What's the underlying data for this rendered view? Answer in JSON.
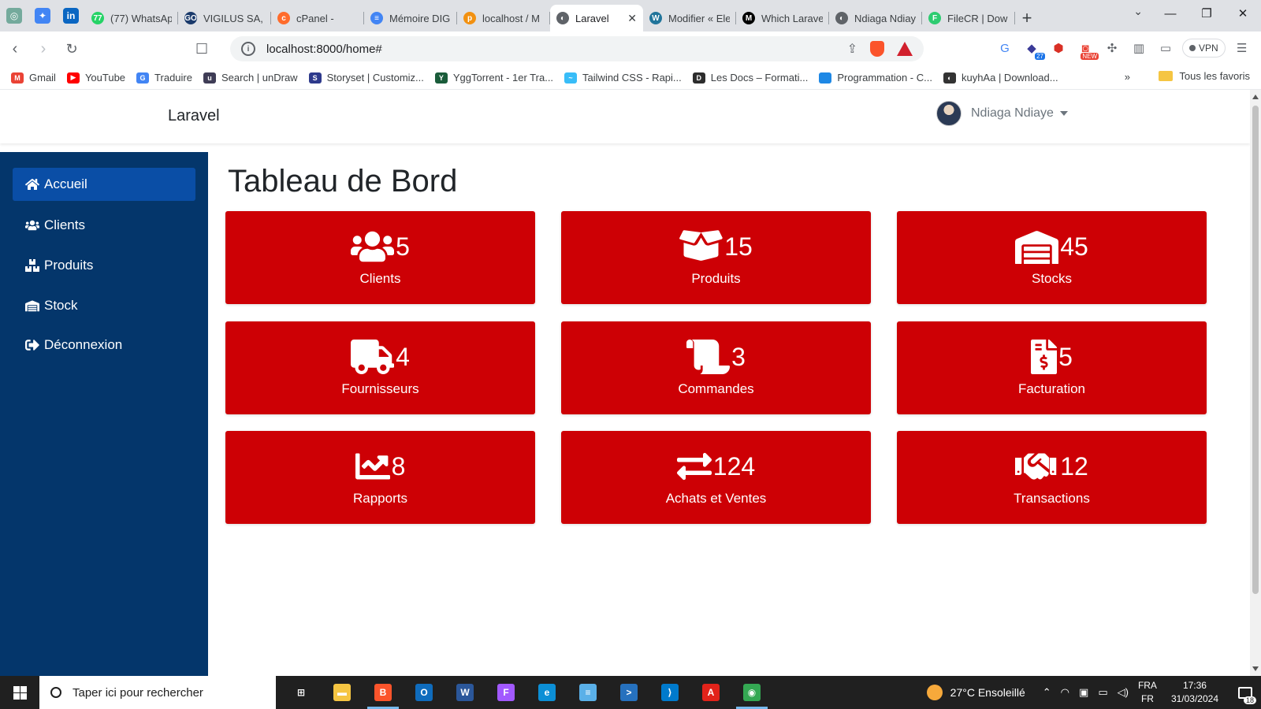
{
  "browser": {
    "pinned_tabs": [
      {
        "icon": "chatgpt-icon",
        "color": "#74aa9c",
        "glyph": "◎"
      },
      {
        "icon": "gemini-icon",
        "color": "#4285f4",
        "glyph": "✦"
      },
      {
        "icon": "linkedin-icon",
        "color": "#0a66c2",
        "glyph": "in"
      }
    ],
    "tabs": [
      {
        "title": "(77) WhatsAp",
        "color": "#25d366",
        "glyph": "77"
      },
      {
        "title": "VIGILUS SA, c",
        "color": "#1a3a6b",
        "glyph": "GO"
      },
      {
        "title": "cPanel -",
        "color": "#ff6c2c",
        "glyph": "c"
      },
      {
        "title": "Mémoire DIG",
        "color": "#4285f4",
        "glyph": "≡"
      },
      {
        "title": "localhost / M",
        "color": "#f29111",
        "glyph": "p"
      },
      {
        "title": "Laravel",
        "color": "#5f6368",
        "glyph": "◐",
        "active": true
      },
      {
        "title": "Modifier « Ele",
        "color": "#21759b",
        "glyph": "W"
      },
      {
        "title": "Which Larave",
        "color": "#000000",
        "glyph": "M"
      },
      {
        "title": "Ndiaga Ndiay",
        "color": "#5f6368",
        "glyph": "◐"
      },
      {
        "title": "FileCR | Dow",
        "color": "#2ecc71",
        "glyph": "F"
      }
    ],
    "tab_close": "✕",
    "new_tab": "+",
    "window_controls": {
      "minimize": "—",
      "restore": "❐",
      "close": "✕"
    },
    "url": "localhost:8000/home#",
    "vpn_label": "VPN",
    "extension_badges": {
      "count": "27",
      "new": "NEW"
    }
  },
  "bookmarks": {
    "items": [
      {
        "label": "Gmail",
        "color": "#ea4335",
        "glyph": "M"
      },
      {
        "label": "YouTube",
        "color": "#ff0000",
        "glyph": "▶"
      },
      {
        "label": "Traduire",
        "color": "#4285f4",
        "glyph": "G"
      },
      {
        "label": "Search | unDraw",
        "color": "#3f3d56",
        "glyph": "u"
      },
      {
        "label": "Storyset | Customiz...",
        "color": "#2e3a8c",
        "glyph": "S"
      },
      {
        "label": "YggTorrent - 1er Tra...",
        "color": "#1a5c3a",
        "glyph": "Y"
      },
      {
        "label": "Tailwind CSS - Rapi...",
        "color": "#38bdf8",
        "glyph": "~"
      },
      {
        "label": "Les Docs – Formati...",
        "color": "#2d2d2d",
        "glyph": "D"
      },
      {
        "label": "Programmation - C...",
        "color": "#1e88e5",
        "glyph": "</>"
      },
      {
        "label": "kuyhAa | Download...",
        "color": "#333333",
        "glyph": "◐"
      }
    ],
    "more": "»",
    "all_favorites": "Tous les favoris"
  },
  "app": {
    "brand": "Laravel",
    "user_name": "Ndiaga Ndiaye",
    "sidebar": [
      {
        "label": "Accueil",
        "icon": "home-icon",
        "active": true
      },
      {
        "label": "Clients",
        "icon": "users-icon"
      },
      {
        "label": "Produits",
        "icon": "boxes-icon"
      },
      {
        "label": "Stock",
        "icon": "warehouse-icon"
      },
      {
        "label": "Déconnexion",
        "icon": "sign-out-icon"
      }
    ],
    "page_title": "Tableau de Bord",
    "card_color": "#cd0005",
    "sidebar_color": "#04366b",
    "cards": [
      {
        "value": "5",
        "label": "Clients",
        "icon": "users-icon"
      },
      {
        "value": "15",
        "label": "Produits",
        "icon": "box-open-icon"
      },
      {
        "value": "45",
        "label": "Stocks",
        "icon": "warehouse-icon"
      },
      {
        "value": "4",
        "label": "Fournisseurs",
        "icon": "truck-icon"
      },
      {
        "value": "3",
        "label": "Commandes",
        "icon": "scroll-icon"
      },
      {
        "value": "5",
        "label": "Facturation",
        "icon": "file-invoice-dollar-icon"
      },
      {
        "value": "8",
        "label": "Rapports",
        "icon": "chart-line-icon"
      },
      {
        "value": "124",
        "label": "Achats et Ventes",
        "icon": "exchange-icon"
      },
      {
        "value": "12",
        "label": "Transactions",
        "icon": "handshake-icon"
      }
    ]
  },
  "taskbar": {
    "search_placeholder": "Taper ici pour rechercher",
    "apps": [
      {
        "icon": "task-view-icon",
        "color": "#202020",
        "glyph": "⊞"
      },
      {
        "icon": "file-explorer-icon",
        "color": "#f5c542",
        "glyph": "▬"
      },
      {
        "icon": "brave-icon",
        "color": "#fb542b",
        "glyph": "B",
        "open": true
      },
      {
        "icon": "outlook-icon",
        "color": "#0f6cbd",
        "glyph": "O"
      },
      {
        "icon": "word-icon",
        "color": "#2b579a",
        "glyph": "W"
      },
      {
        "icon": "figma-icon",
        "color": "#a259ff",
        "glyph": "F"
      },
      {
        "icon": "edge-icon",
        "color": "#0c8fd6",
        "glyph": "e"
      },
      {
        "icon": "notepad-icon",
        "color": "#5ab0e8",
        "glyph": "≡"
      },
      {
        "icon": "powershell-icon",
        "color": "#2671be",
        "glyph": ">"
      },
      {
        "icon": "vscode-icon",
        "color": "#007acc",
        "glyph": "⟩"
      },
      {
        "icon": "acrobat-icon",
        "color": "#e2231a",
        "glyph": "A"
      },
      {
        "icon": "chrome-icon",
        "color": "#34a853",
        "glyph": "◉",
        "open": true
      }
    ],
    "weather": "27°C  Ensoleillé",
    "lang_top": "FRA",
    "lang_bottom": "FR",
    "time": "17:36",
    "date": "31/03/2024",
    "notification_count": "18"
  }
}
